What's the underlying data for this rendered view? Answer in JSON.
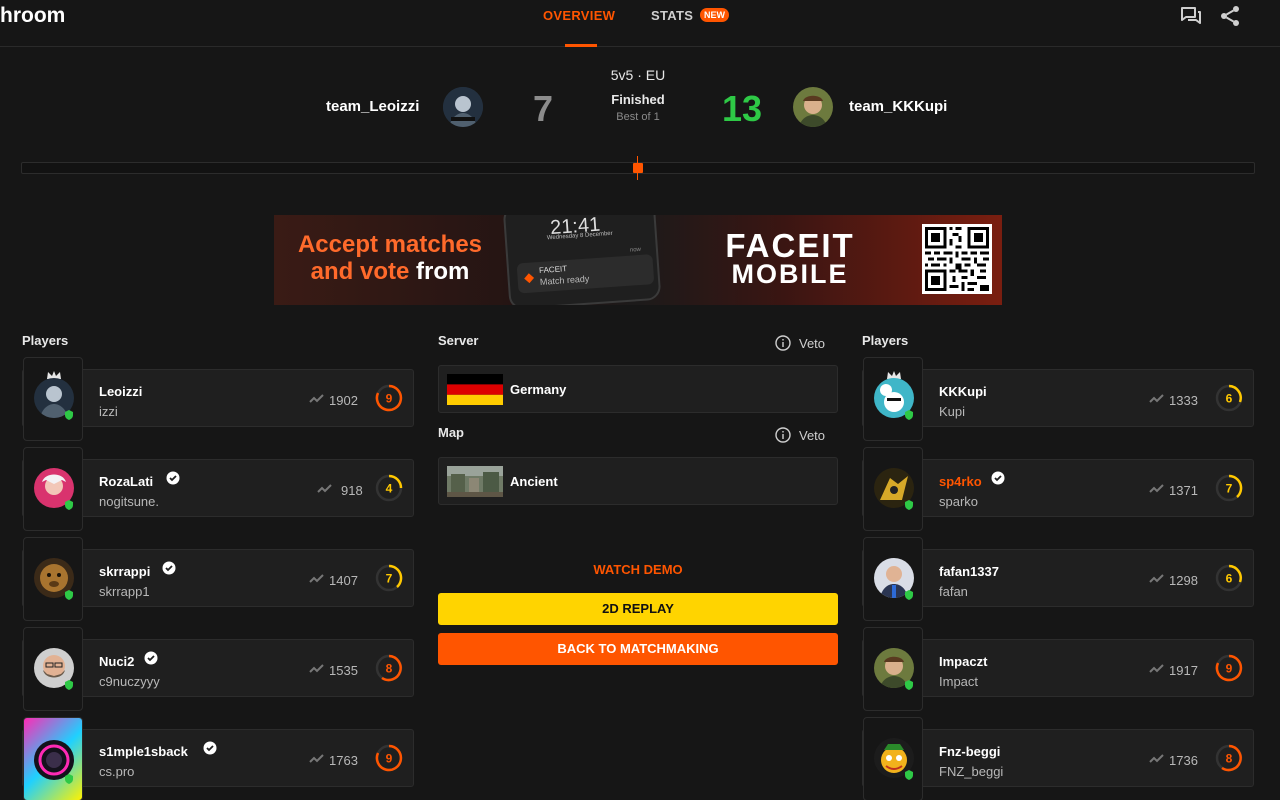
{
  "header": {
    "brand": "hroom",
    "tabs": [
      {
        "label": "OVERVIEW",
        "active": true
      },
      {
        "label": "STATS",
        "badge": "NEW"
      }
    ],
    "icons": [
      "chat-icon",
      "share-icon"
    ]
  },
  "match": {
    "team1": {
      "name": "team_Leoizzi",
      "score": "7"
    },
    "team2": {
      "name": "team_KKKupi",
      "score": "13"
    },
    "format": "5v5 · EU",
    "status": "Finished",
    "best_of": "Best of 1",
    "colors": {
      "team1_score": "#8c8c8c",
      "team2_score": "#2ec946",
      "accent": "#ff5500"
    }
  },
  "banner": {
    "line1": "Accept matches",
    "line2_orange": "and vote",
    "line2_white": "from",
    "phone_time": "21:41",
    "phone_date": "Wednesday 8 December",
    "phone_now": "now",
    "notif_title": "FACEIT",
    "notif_text": "Match ready",
    "brand": "FACEIT",
    "brand_sub": "MOBILE"
  },
  "left_players": {
    "title": "Players",
    "items": [
      {
        "name": "Leoizzi",
        "sub": "izzi",
        "elo": "1902",
        "level": "9",
        "verified": false,
        "leader": true,
        "level_color": "#ff5500"
      },
      {
        "name": "RozaLati",
        "sub": "nogitsune.",
        "elo": "918",
        "level": "4",
        "verified": true,
        "leader": false,
        "level_color": "#ffc800"
      },
      {
        "name": "skrrappi",
        "sub": "skrrapp1",
        "elo": "1407",
        "level": "7",
        "verified": true,
        "leader": false,
        "level_color": "#ffc800"
      },
      {
        "name": "Nuci2",
        "sub": "c9nuczyyy",
        "elo": "1535",
        "level": "8",
        "verified": true,
        "leader": false,
        "level_color": "#ff5500"
      },
      {
        "name": "s1mple1sback",
        "sub": "cs.pro",
        "elo": "1763",
        "level": "9",
        "verified": true,
        "leader": false,
        "level_color": "#ff5500"
      }
    ]
  },
  "right_players": {
    "title": "Players",
    "items": [
      {
        "name": "KKKupi",
        "sub": "Kupi",
        "elo": "1333",
        "level": "6",
        "verified": false,
        "leader": true,
        "level_color": "#ffc800"
      },
      {
        "name": "sp4rko",
        "sub": "sparko",
        "elo": "1371",
        "level": "7",
        "verified": true,
        "leader": false,
        "level_color": "#ffc800",
        "highlight": true
      },
      {
        "name": "fafan1337",
        "sub": "fafan",
        "elo": "1298",
        "level": "6",
        "verified": false,
        "leader": false,
        "level_color": "#ffc800"
      },
      {
        "name": "Impaczt",
        "sub": "Impact",
        "elo": "1917",
        "level": "9",
        "verified": false,
        "leader": false,
        "level_color": "#ff5500"
      },
      {
        "name": "Fnz-beggi",
        "sub": "FNZ_beggi",
        "elo": "1736",
        "level": "8",
        "verified": false,
        "leader": false,
        "level_color": "#ff5500"
      }
    ]
  },
  "center": {
    "server_title": "Server",
    "server_value": "Germany",
    "map_title": "Map",
    "map_value": "Ancient",
    "veto_label": "Veto",
    "watch_demo": "WATCH DEMO",
    "replay_button": "2D REPLAY",
    "back_button": "BACK TO MATCHMAKING"
  }
}
